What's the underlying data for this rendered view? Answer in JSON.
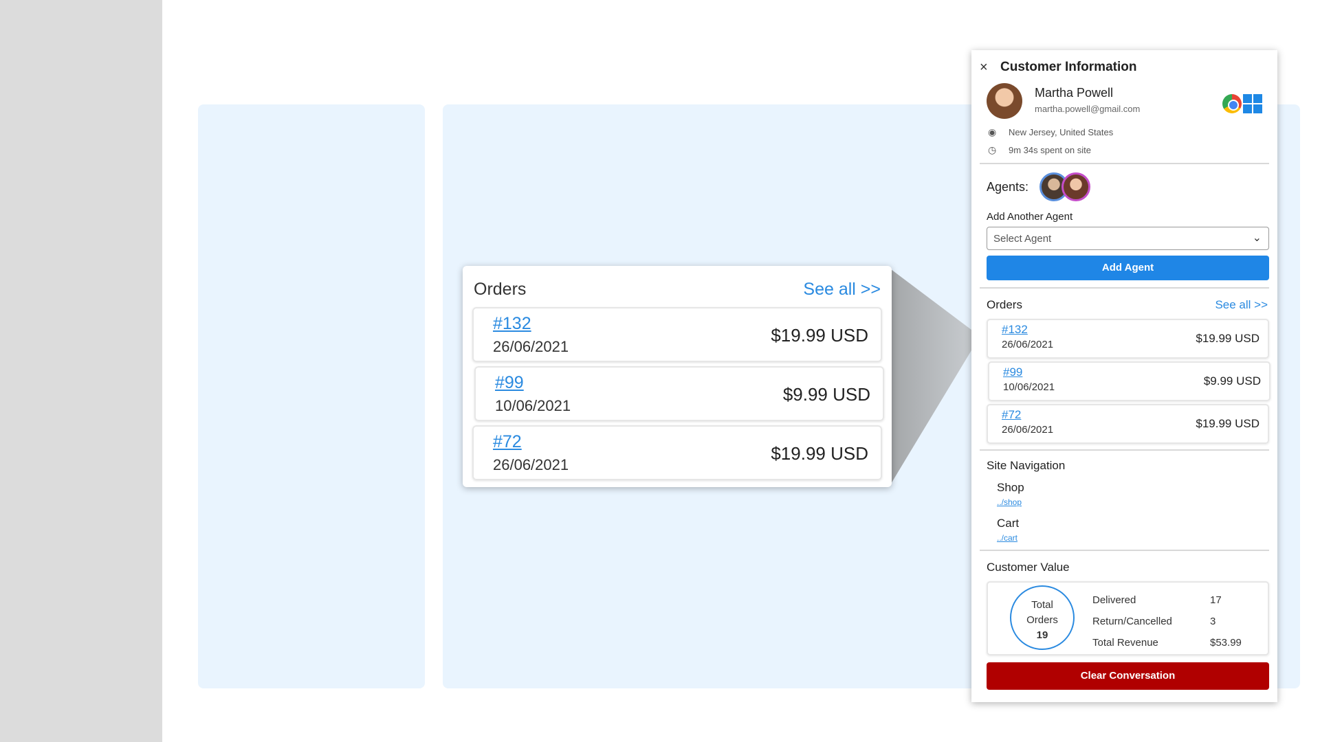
{
  "zoom": {
    "orders_title": "Orders",
    "see_all": "See all >>",
    "orders": [
      {
        "id": "#132",
        "date": "26/06/2021",
        "price": "$19.99 USD"
      },
      {
        "id": "#99",
        "date": "10/06/2021",
        "price": "$9.99 USD"
      },
      {
        "id": "#72",
        "date": "26/06/2021",
        "price": "$19.99 USD"
      }
    ]
  },
  "panel": {
    "close_glyph": "×",
    "title": "Customer Information",
    "customer": {
      "name": "Martha Powell",
      "email": "martha.powell@gmail.com",
      "location": "New Jersey, United States",
      "time_on_site": "9m 34s spent on site"
    },
    "icons": {
      "location": "location-pin-icon",
      "clock": "clock-icon",
      "browser": "chrome-icon",
      "os": "windows-icon",
      "chevron": "chevron-down-icon"
    },
    "agents_label": "Agents:",
    "add_agent_label": "Add Another Agent",
    "select_placeholder": "Select Agent",
    "add_agent_button": "Add Agent",
    "orders_title": "Orders",
    "see_all": "See all >>",
    "orders": [
      {
        "id": "#132",
        "date": "26/06/2021",
        "price": "$19.99 USD"
      },
      {
        "id": "#99",
        "date": "10/06/2021",
        "price": "$9.99 USD"
      },
      {
        "id": "#72",
        "date": "26/06/2021",
        "price": "$19.99 USD"
      }
    ],
    "site_navigation_title": "Site Navigation",
    "navigation": [
      {
        "name": "Shop",
        "path": "../shop"
      },
      {
        "name": "Cart",
        "path": "../cart"
      }
    ],
    "customer_value_title": "Customer Value",
    "total_orders_line1": "Total",
    "total_orders_line2": "Orders",
    "total_orders_value": "19",
    "stats": [
      {
        "label": "Delivered",
        "value": "17"
      },
      {
        "label": "Return/Cancelled",
        "value": "3"
      },
      {
        "label": "Total Revenue",
        "value": "$53.99"
      }
    ],
    "clear_button": "Clear Conversation"
  },
  "colors": {
    "accent_blue": "#1f86e6",
    "link_blue": "#2a8ae0",
    "danger_red": "#b00000",
    "panel_bg": "#e9f4fe"
  }
}
